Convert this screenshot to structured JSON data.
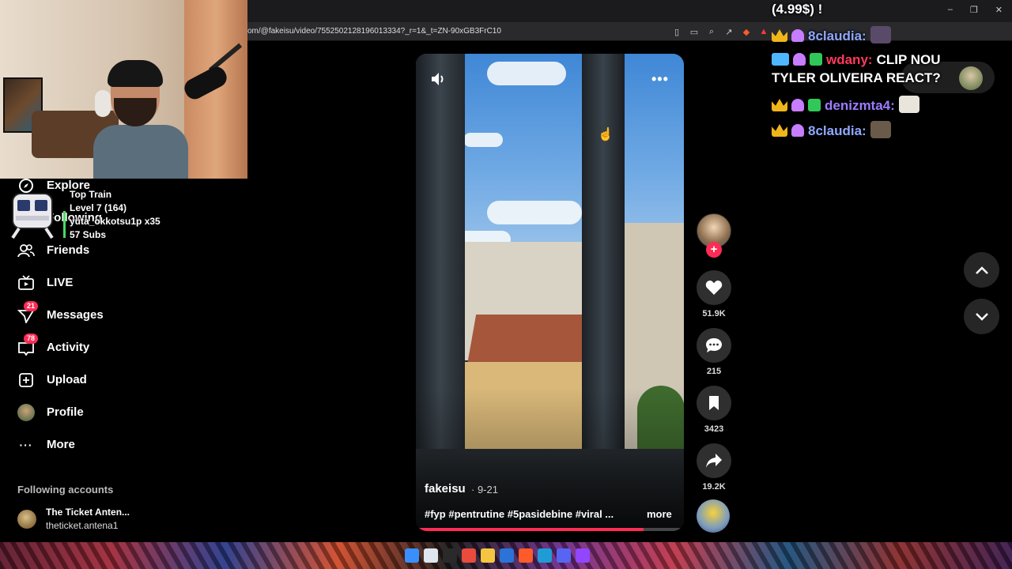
{
  "browser": {
    "url": "om/@fakeisu/video/7552502128196013334?_r=1&_t=ZN-90xGB3FrC10",
    "toolbar_icons": [
      "reader-icon",
      "cast-icon",
      "zoom-icon",
      "share-icon",
      "brave-shield-icon",
      "brave-rewards-icon",
      "extensions-icon",
      "bookmark-icon",
      "sidebar-icon",
      "wallet-icon",
      "leo-icon",
      "vpn-icon",
      "menu-icon"
    ],
    "window_controls": {
      "minimize": "–",
      "restore": "❐",
      "close": "✕"
    }
  },
  "sidebar": {
    "items": [
      {
        "label": "Explore",
        "icon": "compass-icon"
      },
      {
        "label": "Following",
        "icon": "following-icon"
      },
      {
        "label": "Friends",
        "icon": "friends-icon"
      },
      {
        "label": "LIVE",
        "icon": "live-tv-icon"
      },
      {
        "label": "Messages",
        "icon": "paper-plane-icon",
        "badge": "21"
      },
      {
        "label": "Activity",
        "icon": "inbox-icon",
        "badge": "78"
      },
      {
        "label": "Upload",
        "icon": "plus-square-icon"
      },
      {
        "label": "Profile",
        "icon": "profile-avatar"
      },
      {
        "label": "More",
        "icon": "dots-icon"
      }
    ],
    "following_title": "Following accounts",
    "following_accounts": [
      {
        "name": "The Ticket Anten...",
        "handle": "theticket.antena1"
      }
    ]
  },
  "train_overlay": {
    "line1": "Top Train",
    "line2": "Level 7  (164)",
    "line3": "yuta_okkotsu1p x35",
    "line4": "57 Subs"
  },
  "video": {
    "author": "fakeisu",
    "date": "· 9-21",
    "caption": "#fyp #pentrutine #5pasidebine #viral ...",
    "more_label": "more",
    "menu_label": "•••",
    "progress": 0.85
  },
  "actions": {
    "follow_plus": "+",
    "likes": "51.9K",
    "comments": "215",
    "bookmarks": "3423",
    "shares": "19.2K"
  },
  "chat": {
    "top_line": "(4.99$) !",
    "messages": [
      {
        "user": "8claudia:",
        "user_color": "#8fa8ff",
        "text": "",
        "badges": [
          "crown",
          "mascot"
        ]
      },
      {
        "user": "wdany:",
        "user_color": "#ff3a5c",
        "text": "CLIP NOU",
        "badges": [
          "sixteen",
          "mascot",
          "gift"
        ]
      },
      {
        "user": "",
        "user_color": "#ffffff",
        "text": "TYLER OLIVEIRA REACT?",
        "badges": []
      },
      {
        "user": "denizmta4:",
        "user_color": "#9d7cff",
        "text": "",
        "badges": [
          "crown",
          "mascot",
          "gift"
        ]
      },
      {
        "user": "8claudia:",
        "user_color": "#8fa8ff",
        "text": "",
        "badges": [
          "crown",
          "mascot"
        ]
      }
    ]
  },
  "colors": {
    "accent": "#fe2c55",
    "background": "#000000",
    "train_bar": "#4cd964"
  }
}
